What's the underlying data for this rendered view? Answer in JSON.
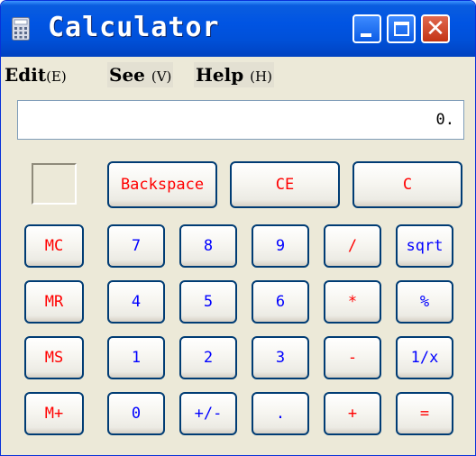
{
  "window": {
    "title": "Calculator"
  },
  "menu": [
    {
      "label": "Edit",
      "key": "(E)"
    },
    {
      "label": "See",
      "key": "(V)"
    },
    {
      "label": "Help",
      "key": "(H)"
    }
  ],
  "display": {
    "value": "0."
  },
  "buttons": {
    "backspace": "Backspace",
    "ce": "CE",
    "c": "C",
    "mc": "MC",
    "mr": "MR",
    "ms": "MS",
    "mplus": "M+",
    "d7": "7",
    "d8": "8",
    "d9": "9",
    "d4": "4",
    "d5": "5",
    "d6": "6",
    "d1": "1",
    "d2": "2",
    "d3": "3",
    "d0": "0",
    "sign": "+/-",
    "dot": ".",
    "div": "/",
    "mul": "*",
    "sub": "-",
    "add": "+",
    "sqrt": "sqrt",
    "pct": "%",
    "inv": "1/x",
    "eq": "="
  },
  "colors": {
    "title_bar": "#0054e3",
    "operator_text": "#ff0000",
    "digit_text": "#0000ff",
    "button_border": "#003c74",
    "window_bg": "#ece9d8"
  }
}
